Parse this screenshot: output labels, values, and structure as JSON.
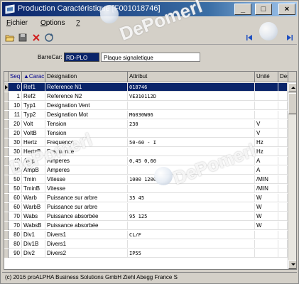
{
  "window": {
    "title": "Production Caractéristique [F001018746]"
  },
  "menu": {
    "items": [
      {
        "accel": "F",
        "rest": "ichier"
      },
      {
        "accel": "O",
        "rest": "ptions"
      },
      {
        "accel": "?",
        "rest": ""
      }
    ]
  },
  "toolbar": {
    "icons": [
      "folder-open-icon",
      "save-icon",
      "delete-icon",
      "refresh-icon",
      "first-record-icon",
      "last-record-icon"
    ]
  },
  "barrecar": {
    "label": "BarreCar:",
    "value": "RD-PLO",
    "description": "Plaque signaletique"
  },
  "grid": {
    "headers": {
      "seq": "Seq",
      "carac": "Carac",
      "designation": "Désignation",
      "attribut": "Attribut",
      "unite": "Unité",
      "des2": "Des"
    },
    "rows": [
      {
        "seq": "0",
        "carac": "Ref1",
        "designation": "Reference N1",
        "attribut": "018746",
        "unite": ""
      },
      {
        "seq": "1",
        "carac": "Ref2",
        "designation": "Reference N2",
        "attribut": "VE310112D",
        "unite": ""
      },
      {
        "seq": "10",
        "carac": "Typ1",
        "designation": "Designation Vent",
        "attribut": "",
        "unite": ""
      },
      {
        "seq": "11",
        "carac": "Typ2",
        "designation": "Designation Mot",
        "attribut": "MG030W06",
        "unite": ""
      },
      {
        "seq": "20",
        "carac": "Volt",
        "designation": "Tension",
        "attribut": "230",
        "unite": "V"
      },
      {
        "seq": "20",
        "carac": "VoltB",
        "designation": "Tension",
        "attribut": "",
        "unite": "V"
      },
      {
        "seq": "30",
        "carac": "Hertz",
        "designation": "Frequence",
        "attribut": "50-60 - I",
        "unite": "Hz"
      },
      {
        "seq": "30",
        "carac": "HertzB",
        "designation": "Frequence",
        "attribut": "",
        "unite": "Hz"
      },
      {
        "seq": "40",
        "carac": "Amp",
        "designation": "Amperes",
        "attribut": "0,45 0,60",
        "unite": "A"
      },
      {
        "seq": "40",
        "carac": "AmpB",
        "designation": "Amperes",
        "attribut": "",
        "unite": "A"
      },
      {
        "seq": "50",
        "carac": "Tmin",
        "designation": "Vitesse",
        "attribut": "1000 1200",
        "unite": "/MIN"
      },
      {
        "seq": "50",
        "carac": "TminB",
        "designation": "Vitesse",
        "attribut": "",
        "unite": "/MIN"
      },
      {
        "seq": "60",
        "carac": "Warb",
        "designation": "Puissance sur arbre",
        "attribut": "35 45",
        "unite": "W"
      },
      {
        "seq": "60",
        "carac": "WarbB",
        "designation": "Puissance sur arbre",
        "attribut": "",
        "unite": "W"
      },
      {
        "seq": "70",
        "carac": "Wabs",
        "designation": "Puissance absorbée",
        "attribut": "95 125",
        "unite": "W"
      },
      {
        "seq": "70",
        "carac": "WabsB",
        "designation": "Puissance absorbée",
        "attribut": "",
        "unite": "W"
      },
      {
        "seq": "80",
        "carac": "Div1",
        "designation": "Divers1",
        "attribut": "CL/F",
        "unite": ""
      },
      {
        "seq": "80",
        "carac": "Div1B",
        "designation": "Divers1",
        "attribut": "",
        "unite": ""
      },
      {
        "seq": "90",
        "carac": "Div2",
        "designation": "Divers2",
        "attribut": "IP55",
        "unite": ""
      }
    ]
  },
  "status": {
    "left": "(c) 2016 proALPHA Business Solutions GmbH",
    "right": "Ziehl Abegg France S"
  },
  "watermark": {
    "text": "DePomerl"
  },
  "colors": {
    "selection": "#0a246a",
    "title_gradient_start": "#0a246a",
    "window_bg": "#d4d0c8"
  }
}
